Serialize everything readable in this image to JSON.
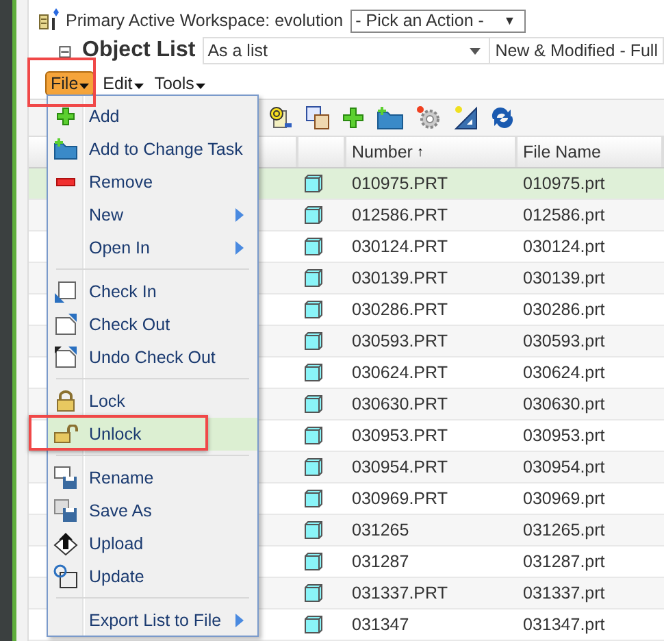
{
  "workspace": {
    "label": "Primary Active Workspace: evolution",
    "action_select": "- Pick an Action -",
    "action_arrow": "▼"
  },
  "object_list": {
    "collapse": "⊟",
    "title": "Object List",
    "view_select": "As a list",
    "filter_select": "New & Modified - Full"
  },
  "menu_bar": [
    {
      "label": "File",
      "open": true
    },
    {
      "label": "Edit",
      "open": false
    },
    {
      "label": "Tools",
      "open": false
    }
  ],
  "file_menu": [
    {
      "kind": "item",
      "label": "Add",
      "submenu": false,
      "selected": false
    },
    {
      "kind": "item",
      "label": "Add to Change Task",
      "submenu": false,
      "selected": false
    },
    {
      "kind": "item",
      "label": "Remove",
      "submenu": false,
      "selected": false
    },
    {
      "kind": "item",
      "label": "New",
      "submenu": true,
      "selected": false
    },
    {
      "kind": "item",
      "label": "Open In",
      "submenu": true,
      "selected": false
    },
    {
      "kind": "separator"
    },
    {
      "kind": "item",
      "label": "Check In",
      "submenu": false,
      "selected": false
    },
    {
      "kind": "item",
      "label": "Check Out",
      "submenu": false,
      "selected": false
    },
    {
      "kind": "item",
      "label": "Undo Check Out",
      "submenu": false,
      "selected": false
    },
    {
      "kind": "separator"
    },
    {
      "kind": "item",
      "label": "Lock",
      "submenu": false,
      "selected": false
    },
    {
      "kind": "item",
      "label": "Unlock",
      "submenu": false,
      "selected": true
    },
    {
      "kind": "separator"
    },
    {
      "kind": "item",
      "label": "Rename",
      "submenu": false,
      "selected": false
    },
    {
      "kind": "item",
      "label": "Save As",
      "submenu": false,
      "selected": false
    },
    {
      "kind": "item",
      "label": "Upload",
      "submenu": false,
      "selected": false
    },
    {
      "kind": "item",
      "label": "Update",
      "submenu": false,
      "selected": false
    },
    {
      "kind": "separator"
    },
    {
      "kind": "item",
      "label": "Export List to File",
      "submenu": true,
      "selected": false
    }
  ],
  "table": {
    "columns": [
      {
        "kind": "blank"
      },
      {
        "kind": "blank"
      },
      {
        "kind": "text",
        "label": "Number",
        "sort": "↑"
      },
      {
        "kind": "text",
        "label": "File Name"
      }
    ],
    "rows": [
      {
        "number": "010975.PRT",
        "file_name": "010975.prt",
        "selected": true
      },
      {
        "number": "012586.PRT",
        "file_name": "012586.prt",
        "selected": false
      },
      {
        "number": "030124.PRT",
        "file_name": "030124.prt",
        "selected": false
      },
      {
        "number": "030139.PRT",
        "file_name": "030139.prt",
        "selected": false
      },
      {
        "number": "030286.PRT",
        "file_name": "030286.prt",
        "selected": false
      },
      {
        "number": "030593.PRT",
        "file_name": "030593.prt",
        "selected": false
      },
      {
        "number": "030624.PRT",
        "file_name": "030624.prt",
        "selected": false
      },
      {
        "number": "030630.PRT",
        "file_name": "030630.prt",
        "selected": false
      },
      {
        "number": "030953.PRT",
        "file_name": "030953.prt",
        "selected": false
      },
      {
        "number": "030954.PRT",
        "file_name": "030954.prt",
        "selected": false
      },
      {
        "number": "030969.PRT",
        "file_name": "030969.prt",
        "selected": false
      },
      {
        "number": "031265",
        "file_name": "031265.prt",
        "selected": false
      },
      {
        "number": "031287",
        "file_name": "031287.prt",
        "selected": false
      },
      {
        "number": "031337.PRT",
        "file_name": "031337.prt",
        "selected": false
      },
      {
        "number": "031347",
        "file_name": "031347.prt",
        "selected": false
      }
    ]
  }
}
